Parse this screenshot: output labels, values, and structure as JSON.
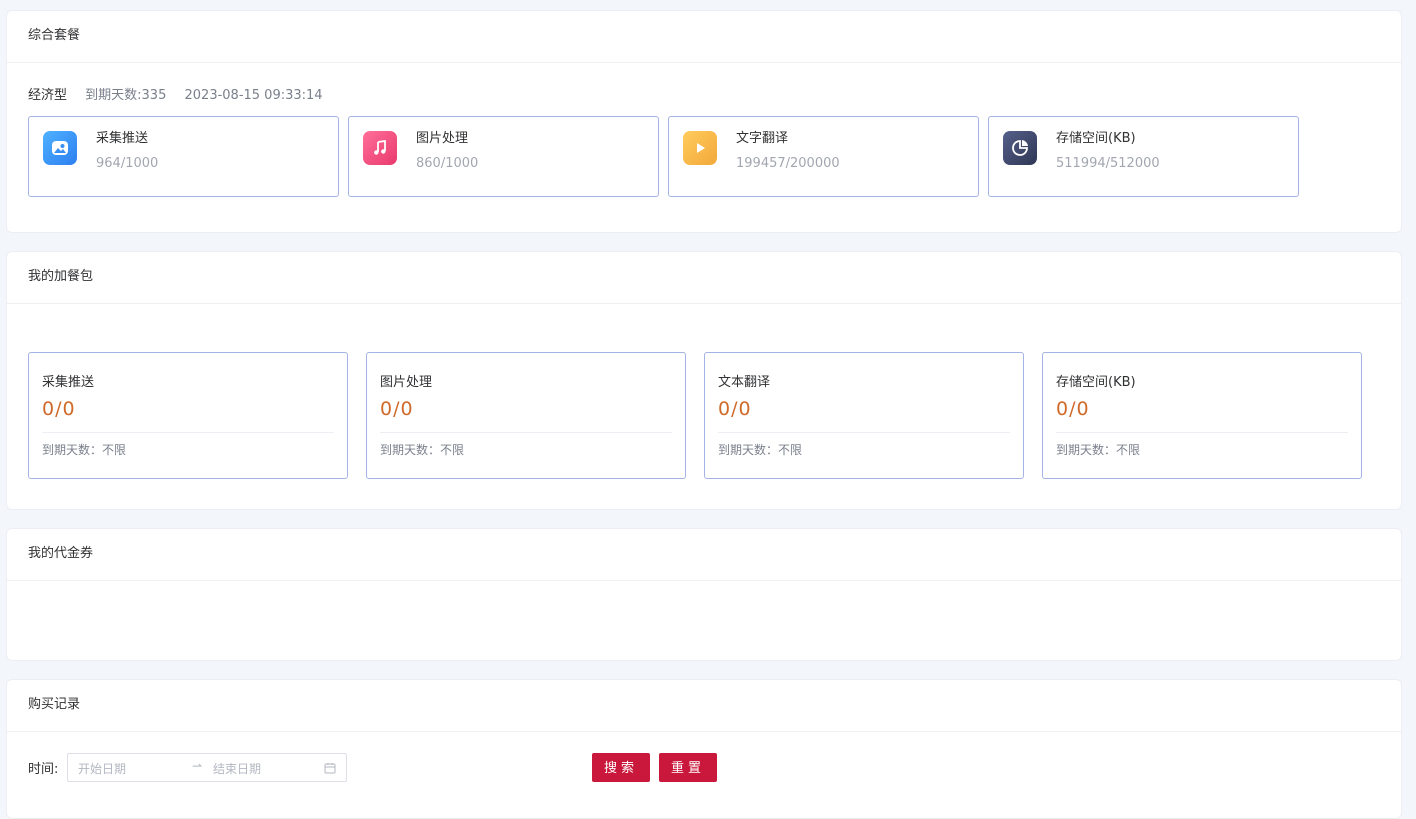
{
  "package": {
    "title": "综合套餐",
    "plan_name": "经济型",
    "days_left": "到期天数:335",
    "expire_time": "2023-08-15 09:33:14",
    "services": [
      {
        "name": "采集推送",
        "value": "964/1000",
        "icon": "image-icon",
        "color": "#3a8ff5"
      },
      {
        "name": "图片处理",
        "value": "860/1000",
        "icon": "music-icon",
        "color": "#f0467a"
      },
      {
        "name": "文字翻译",
        "value": "199457/200000",
        "icon": "play-icon",
        "color": "#f5b53e"
      },
      {
        "name": "存储空间(KB)",
        "value": "511994/512000",
        "icon": "pie-chart-icon",
        "color": "#3e4766"
      }
    ]
  },
  "addons": {
    "title": "我的加餐包",
    "items": [
      {
        "name": "采集推送",
        "count": "0/0",
        "expire": "到期天数：不限"
      },
      {
        "name": "图片处理",
        "count": "0/0",
        "expire": "到期天数：不限"
      },
      {
        "name": "文本翻译",
        "count": "0/0",
        "expire": "到期天数：不限"
      },
      {
        "name": "存储空间(KB)",
        "count": "0/0",
        "expire": "到期天数：不限"
      }
    ]
  },
  "vouchers": {
    "title": "我的代金券"
  },
  "records": {
    "title": "购买记录",
    "time_label": "时间:",
    "start_placeholder": "开始日期",
    "end_placeholder": "结束日期",
    "search_label": "搜索",
    "reset_label": "重置"
  }
}
